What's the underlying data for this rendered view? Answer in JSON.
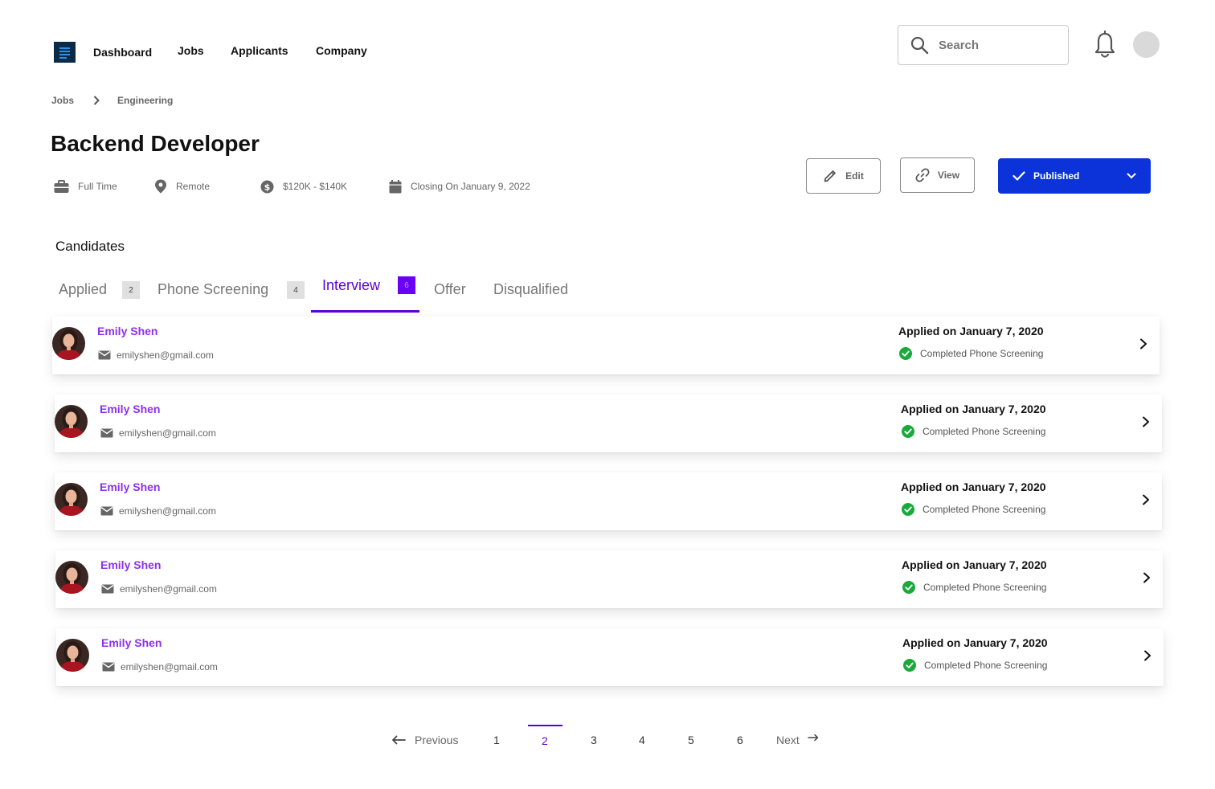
{
  "nav": {
    "links": [
      "Dashboard",
      "Jobs",
      "Applicants",
      "Company"
    ],
    "search_placeholder": "Search"
  },
  "breadcrumb": [
    "Jobs",
    "Engineering"
  ],
  "job": {
    "title": "Backend Developer",
    "type": "Full Time",
    "location": "Remote",
    "salary": "$120K - $140K",
    "closing": "Closing On January 9, 2022"
  },
  "actions": {
    "edit": "Edit",
    "view": "View",
    "status": "Published"
  },
  "candidates": {
    "heading": "Candidates",
    "tabs": [
      {
        "label": "Applied",
        "count": "2"
      },
      {
        "label": "Phone Screening",
        "count": "4"
      },
      {
        "label": "Interview",
        "count": "6"
      },
      {
        "label": "Offer"
      },
      {
        "label": "Disqualified"
      }
    ],
    "rows": [
      {
        "name": "Emily Shen",
        "email": "emilyshen@gmail.com",
        "applied": "Applied on January 7, 2020",
        "status": "Completed Phone Screening"
      },
      {
        "name": "Emily Shen",
        "email": "emilyshen@gmail.com",
        "applied": "Applied on January 7, 2020",
        "status": "Completed Phone Screening"
      },
      {
        "name": "Emily Shen",
        "email": "emilyshen@gmail.com",
        "applied": "Applied on January 7, 2020",
        "status": "Completed Phone Screening"
      },
      {
        "name": "Emily Shen",
        "email": "emilyshen@gmail.com",
        "applied": "Applied on January 7, 2020",
        "status": "Completed Phone Screening"
      },
      {
        "name": "Emily Shen",
        "email": "emilyshen@gmail.com",
        "applied": "Applied on January 7, 2020",
        "status": "Completed Phone Screening"
      }
    ]
  },
  "pagination": {
    "previous": "Previous",
    "next": "Next",
    "pages": [
      "1",
      "2",
      "3",
      "4",
      "5",
      "6"
    ],
    "current": "2"
  },
  "colors": {
    "accent": "#5a00d6",
    "name": "#8d2ff0",
    "published": "#0b33d9",
    "success": "#1aaa3c"
  }
}
